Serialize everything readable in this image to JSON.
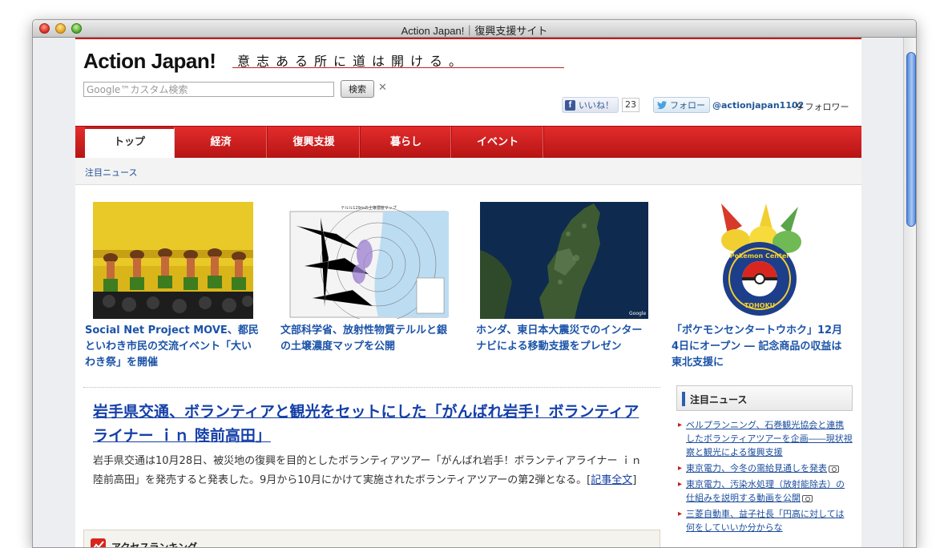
{
  "window": {
    "title": "Action Japan!｜復興支援サイト"
  },
  "header": {
    "logo": "Action Japan!",
    "tagline": "意志ある所に道は開ける。",
    "search_placeholder": "Google™カスタム検索",
    "search_button": "検索",
    "search_clear": "✕",
    "like_label": "いいね！",
    "like_count": "23",
    "follow_label": "フォロー",
    "twitter_handle": "@actionjapan1102",
    "followers": "· 9 フォロワー"
  },
  "nav": {
    "tabs": [
      {
        "label": "トップ",
        "active": true
      },
      {
        "label": "経済",
        "active": false
      },
      {
        "label": "復興支援",
        "active": false
      },
      {
        "label": "暮らし",
        "active": false
      },
      {
        "label": "イベント",
        "active": false
      }
    ],
    "subnav": "注目ニュース"
  },
  "features": [
    {
      "title": "Social Net Project MOVE、都民といわき市民の交流イベント「大いわき祭」を開催",
      "image": "hula-dance-stage"
    },
    {
      "title": "文部科学省、放射性物質テルルと銀の土壌濃度マップを公開",
      "image": "soil-concentration-map",
      "map_caption": "テルル129mの土壌濃度マップ"
    },
    {
      "title": "ホンダ、東日本大震災でのインターナビによる移動支援をプレゼン",
      "image": "satellite-map-tohoku",
      "map_caption": "Google"
    },
    {
      "title": "「ポケモンセンタートウホク」12月4日にオープン ― 記念商品の収益は東北支援に",
      "image": "pokemon-center-tohoku-logo",
      "badge_text_top": "Pokemon Center",
      "badge_text_bottom": "TOHOKU"
    }
  ],
  "lead": {
    "title": "岩手県交通、ボランティアと観光をセットにした「がんばれ岩手！ボランティアライナー ｉｎ 陸前高田」",
    "body": "岩手県交通は10月28日、被災地の復興を目的としたボランティアツアー「がんばれ岩手！ボランティアライナー ｉｎ 陸前高田」を発売すると発表した。9月から10月にかけて実施されたボランティアツアーの第2弾となる。",
    "link_open": "[",
    "link_label": "記事全文",
    "link_close": "]"
  },
  "ranking": {
    "title": "アクセスランキング"
  },
  "sidebar": {
    "title": "注目ニュース",
    "items": [
      {
        "text": "ベルプランニング、石巻観光協会と連携したボランティアツアーを企画――現状視察と観光による復興支援",
        "camera": false
      },
      {
        "text": "東京電力、今冬の需給見通しを発表",
        "camera": true
      },
      {
        "text": "東京電力、汚染水処理（放射能除去）の仕組みを説明する動画を公開",
        "camera": true
      },
      {
        "text": "三菱自動車、益子社長「円高に対しては何をしていいか分からな",
        "camera": false
      }
    ]
  },
  "colors": {
    "brand_red": "#c41e1e",
    "link_blue": "#1b53a8"
  }
}
